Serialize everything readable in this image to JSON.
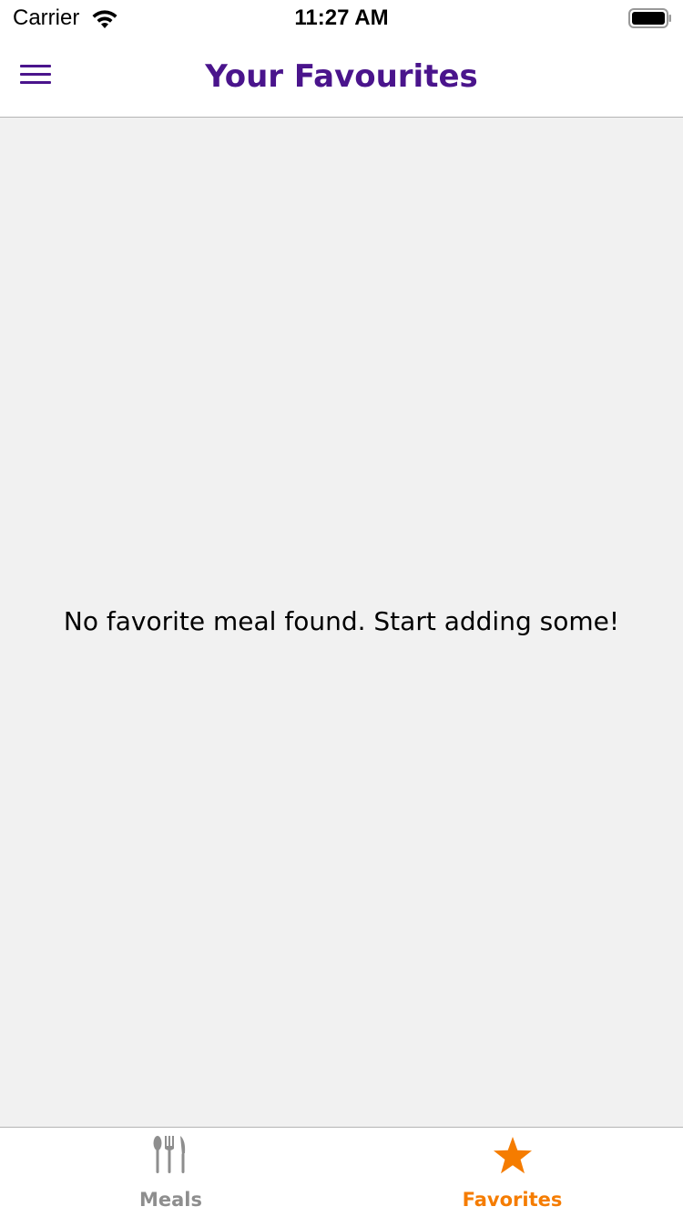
{
  "status_bar": {
    "carrier": "Carrier",
    "time": "11:27 AM",
    "wifi_icon": "wifi-icon",
    "battery_icon": "battery-icon"
  },
  "header": {
    "title": "Your Favourites",
    "menu_icon": "hamburger-menu-icon"
  },
  "content": {
    "empty_message": "No favorite meal found. Start adding some!"
  },
  "tabs": [
    {
      "label": "Meals",
      "icon": "cutlery-icon",
      "active": false
    },
    {
      "label": "Favorites",
      "icon": "star-icon",
      "active": true
    }
  ],
  "colors": {
    "primary": "#4a148c",
    "accent": "#f57c00",
    "inactive": "#8e8e8e",
    "background": "#f1f1f1"
  }
}
